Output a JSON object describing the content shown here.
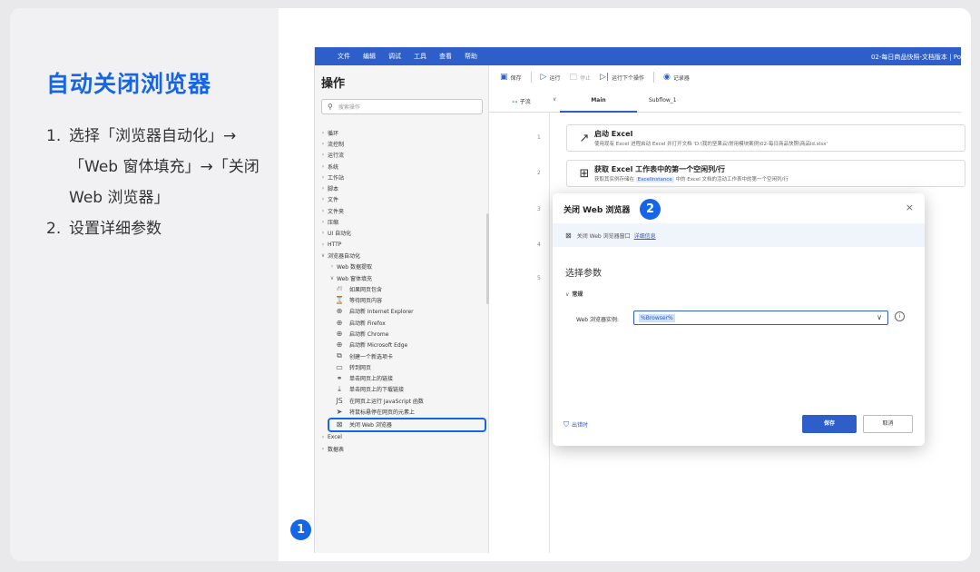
{
  "left": {
    "title": "自动关闭浏览器",
    "steps": [
      {
        "num": "1.",
        "text": "选择「浏览器自动化」→「Web 窗体填充」→「关闭 Web 浏览器」"
      },
      {
        "num": "2.",
        "text": "设置详细参数"
      }
    ]
  },
  "menubar": {
    "items": [
      "文件",
      "编辑",
      "调试",
      "工具",
      "查看",
      "帮助"
    ],
    "doc_title": "02-每日商品快照-文档版本 | Po"
  },
  "sidebar": {
    "title": "操作",
    "search_placeholder": "搜索操作",
    "search_icon": "search-icon",
    "items": [
      {
        "label": "循环"
      },
      {
        "label": "流控制"
      },
      {
        "label": "运行流"
      },
      {
        "label": "系统"
      },
      {
        "label": "工作站"
      },
      {
        "label": "脚本"
      },
      {
        "label": "文件"
      },
      {
        "label": "文件夹"
      },
      {
        "label": "压缩"
      },
      {
        "label": "UI 自动化"
      },
      {
        "label": "HTTP"
      }
    ],
    "browser_group": "浏览器自动化",
    "browser_sub": [
      {
        "label": "Web 数据提取",
        "expanded": false
      },
      {
        "label": "Web 窗体填充",
        "expanded": true
      }
    ],
    "actions": [
      {
        "label": "如果网页包含",
        "icon": "tree-branch-icon",
        "glyph": "⛙"
      },
      {
        "label": "等待网页内容",
        "icon": "hourglass-icon",
        "glyph": "⌛"
      },
      {
        "label": "启动新 Internet Explorer",
        "icon": "globe-icon",
        "glyph": "⊕"
      },
      {
        "label": "启动新 Firefox",
        "icon": "globe-icon",
        "glyph": "⊕"
      },
      {
        "label": "启动新 Chrome",
        "icon": "globe-icon",
        "glyph": "⊕"
      },
      {
        "label": "启动新 Microsoft Edge",
        "icon": "globe-icon",
        "glyph": "⊕"
      },
      {
        "label": "创建一个新选项卡",
        "icon": "new-tab-icon",
        "glyph": "⧉"
      },
      {
        "label": "转到网页",
        "icon": "browser-window-icon",
        "glyph": "▭"
      },
      {
        "label": "单击网页上的链接",
        "icon": "link-icon",
        "glyph": "⚭"
      },
      {
        "label": "单击网页上的下载链接",
        "icon": "download-icon",
        "glyph": "⤓"
      },
      {
        "label": "在网页上运行 JavaScript 函数",
        "icon": "js-icon",
        "glyph": "JS"
      },
      {
        "label": "将鼠标悬停在网页的元素上",
        "icon": "pointer-icon",
        "glyph": "➤"
      }
    ],
    "selected_action": {
      "label": "关闭 Web 浏览器",
      "icon": "close-box-icon",
      "glyph": "⊠"
    },
    "after": [
      {
        "label": "Excel"
      },
      {
        "label": "数据表"
      }
    ]
  },
  "toolbar": {
    "save": "保存",
    "run": "运行",
    "stop": "停止",
    "run_next": "运行下个操作",
    "recorder": "记录器"
  },
  "tabs": {
    "subflow": "子流",
    "main": "Main",
    "subflow1": "Subflow_1"
  },
  "flow": [
    {
      "num": "1",
      "name": "启动 Excel",
      "desc_pre": "使用现有 Excel 进程启动 Excel 并打开文档 'D:\\我的坚果云\\常用模块案例\\02-每日商品快照\\商品id.xlsx'",
      "desc_hl": "",
      "desc_post": "",
      "icon": "excel-launch-icon",
      "glyph": "↗"
    },
    {
      "num": "2",
      "name": "获取 Excel 工作表中的第一个空闲列/行",
      "desc_pre": "获取其实例存储在 ",
      "desc_hl": "ExcelInstance",
      "desc_post": " 中的 Excel 文档的活动工作表中的第一个空闲列/行",
      "icon": "excel-sheet-icon",
      "glyph": "⊞"
    },
    {
      "num": "3"
    },
    {
      "num": "4"
    },
    {
      "num": "5"
    }
  ],
  "dialog": {
    "title": "关闭 Web 浏览器",
    "close": "×",
    "info": "关闭 Web 浏览器窗口",
    "info_link": "详细信息",
    "section": "选择参数",
    "group": "常规",
    "field_label": "Web 浏览器实例:",
    "field_value": "%Browser%",
    "on_error": "出错时",
    "save": "保存",
    "cancel": "取消"
  },
  "badges": {
    "one": "1",
    "two": "2"
  },
  "colors": {
    "accent": "#1565e8",
    "menubar": "#2d5ec9"
  }
}
